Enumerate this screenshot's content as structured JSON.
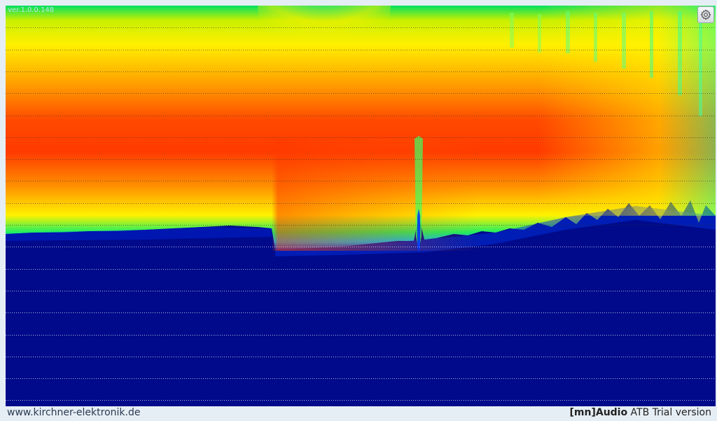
{
  "version_label": "ver.1.0.0.148",
  "footer": {
    "website": "www.kirchner-elektronik.de",
    "brand_bracket_open": "[",
    "brand_mn": "mn",
    "brand_bracket_close": "]",
    "brand_audio": "Audio",
    "brand_rest": " ATB Trial version"
  },
  "icons": {
    "settings": "gear-icon"
  },
  "colors": {
    "background_low": "#000a8a",
    "gridline": "#ffffff",
    "hot": "#ff2a00",
    "warm": "#ff8a00",
    "yellow": "#fff200",
    "green": "#00e850",
    "cyan": "#00e0ff",
    "footer_bg": "#e6eef5"
  }
}
